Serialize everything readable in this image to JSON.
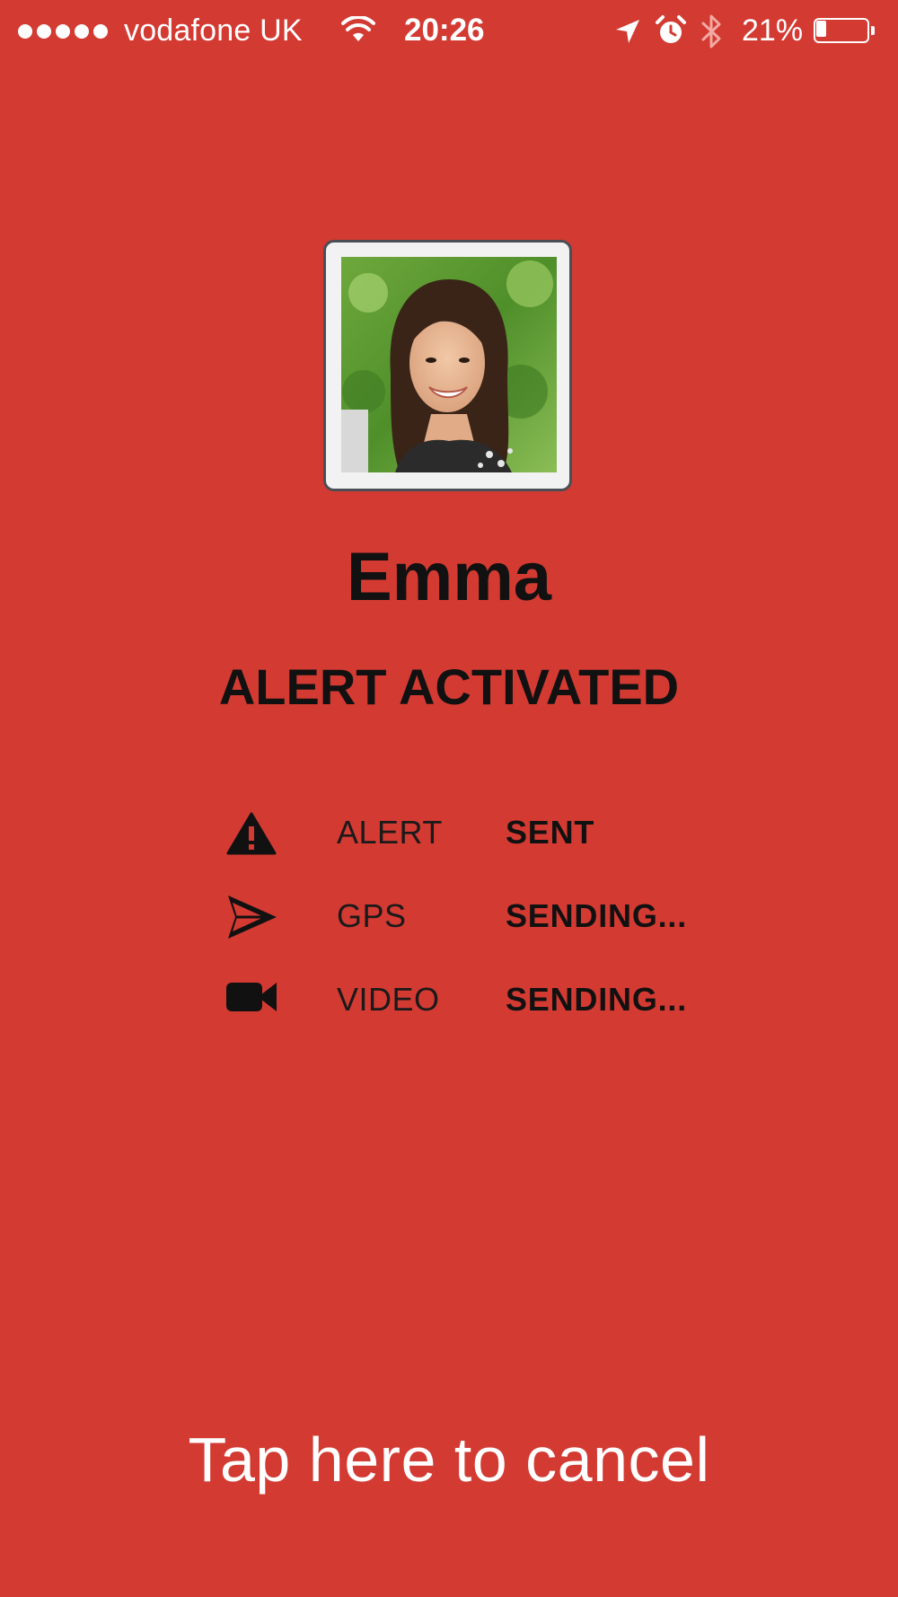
{
  "status_bar": {
    "carrier": "vodafone UK",
    "time": "20:26",
    "battery_percent": "21%",
    "battery_level": 0.21,
    "signal_bars": 5,
    "icons": [
      "wifi-icon",
      "location-arrow-icon",
      "alarm-clock-icon",
      "bluetooth-icon",
      "battery-icon"
    ]
  },
  "contact": {
    "name": "Emma",
    "photo": "profile-photo"
  },
  "alert": {
    "title": "ALERT ACTIVATED",
    "items": [
      {
        "icon": "warning-triangle-icon",
        "label": "ALERT",
        "status": "SENT"
      },
      {
        "icon": "send-arrow-icon",
        "label": "GPS",
        "status": "SENDING..."
      },
      {
        "icon": "video-camera-icon",
        "label": "VIDEO",
        "status": "SENDING..."
      }
    ]
  },
  "cancel": {
    "label": "Tap here to cancel"
  },
  "colors": {
    "background": "#d33a32",
    "text_dark": "#111111",
    "text_light": "#ffffff"
  }
}
